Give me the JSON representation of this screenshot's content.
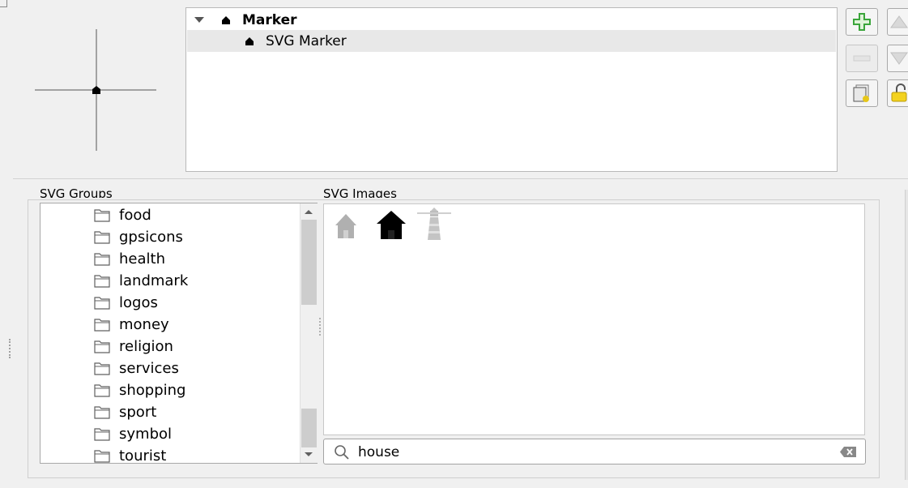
{
  "symbol_tree": {
    "root_label": "Marker",
    "child_label": "SVG Marker"
  },
  "svg_groups": {
    "label": "SVG Groups",
    "items": [
      "food",
      "gpsicons",
      "health",
      "landmark",
      "logos",
      "money",
      "religion",
      "services",
      "shopping",
      "sport",
      "symbol",
      "tourist"
    ]
  },
  "svg_images": {
    "label": "SVG Images",
    "icons": [
      "house-gray-icon",
      "house-black-icon",
      "lighthouse-icon"
    ]
  },
  "search": {
    "value": "house"
  },
  "colors": {
    "add_green": "#3aa53a",
    "lock_yellow": "#e6c619"
  }
}
